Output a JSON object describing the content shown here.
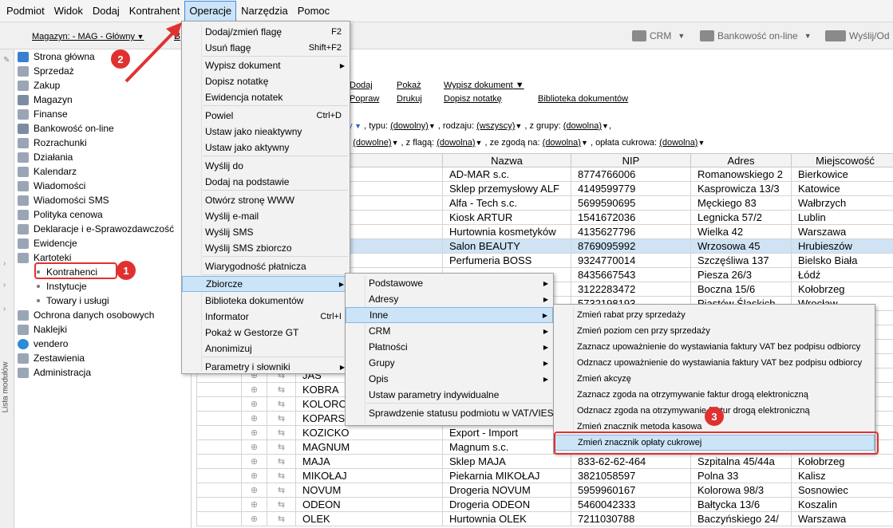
{
  "menubar": [
    "Podmiot",
    "Widok",
    "Dodaj",
    "Kontrahent",
    "Operacje",
    "Narzędzia",
    "Pomoc"
  ],
  "toolbar": {
    "magazyn": "Magazyn: - MAG - Główny",
    "b_label": "B",
    "crm": "CRM",
    "bankowosc": "Bankowość on-line",
    "wyslij": "Wyślij/Od"
  },
  "vstrip_label": "Lista modułów",
  "sidebar": {
    "items": [
      "Strona główna",
      "Sprzedaż",
      "Zakup",
      "Magazyn",
      "Finanse",
      "Bankowość on-line",
      "Rozrachunki",
      "Działania",
      "Kalendarz",
      "Wiadomości",
      "Wiadomości SMS",
      "Polityka cenowa",
      "Deklaracje i e-Sprawozdawczość",
      "Ewidencje",
      "Kartoteki"
    ],
    "kartoteki_sub": [
      "Kontrahenci",
      "Instytucje",
      "Towary i usługi"
    ],
    "items_after": [
      "Ochrona danych osobowych",
      "Naklejki",
      "vendero",
      "Zestawienia",
      "Administracja"
    ]
  },
  "actions": {
    "row1": [
      "Dodaj",
      "Pokaż",
      "Wypisz dokument"
    ],
    "row2": [
      "Popraw",
      "Drukuj",
      "Dopisz notatkę",
      "Biblioteka dokumentów"
    ]
  },
  "filters": {
    "line1_typu": ", typu:",
    "line1_typu_val": "(dowolny)",
    "line1_rodzaju": ", rodzaju:",
    "line1_rodzaju_val": "(wszyscy)",
    "line1_grupy": ", z grupy:",
    "line1_grupy_val": "(dowolna)",
    "line1_tail": ",",
    "line2_a": "a:",
    "line2_a_val": "(dowolne)",
    "line2_flaga": ", z flagą:",
    "line2_flaga_val": "(dowolna)",
    "line2_zgoda": ", ze zgodą na:",
    "line2_zgoda_val": "(dowolna)",
    "line2_oplata": ", opłata cukrowa:",
    "line2_oplata_val": "(dowolna)",
    "line1_cut": "ny"
  },
  "table": {
    "headers": [
      "ymbol",
      "Nazwa",
      "NIP",
      "Adres",
      "Miejscowość"
    ],
    "rows": [
      [
        "",
        "AD-MAR s.c.",
        "8774766006",
        "Romanowskiego 2",
        "Bierkowice"
      ],
      [
        "",
        "Sklep przemysłowy ALF",
        "4149599779",
        "Kasprowicza  13/3",
        "Katowice"
      ],
      [
        "",
        "Alfa - Tech s.c.",
        "5699590695",
        "Męckiego  83",
        "Wałbrzych"
      ],
      [
        "",
        "Kiosk ARTUR",
        "1541672036",
        "Legnicka  57/2",
        "Lublin"
      ],
      [
        "",
        "Hurtownia kosmetyków",
        "4135627796",
        "Wielka  42",
        "Warszawa"
      ],
      [
        "",
        "Salon BEAUTY",
        "8769095992",
        "Wrzosowa  45",
        "Hrubieszów"
      ],
      [
        "",
        "Perfumeria BOSS",
        "9324770014",
        "Szczęśliwa  137",
        "Bielsko Biała"
      ],
      [
        "",
        "",
        "8435667543",
        "Piesza  26/3",
        "Łódź"
      ],
      [
        "",
        "",
        "3122283472",
        "Boczna  15/6",
        "Kołobrzeg"
      ],
      [
        "",
        "",
        "5732198193",
        "Piastów Śląskich",
        "Wrocław"
      ],
      [
        "",
        "",
        "",
        "",
        ""
      ],
      [
        "",
        "",
        "",
        "",
        ""
      ],
      [
        "",
        "",
        "",
        "",
        ""
      ],
      [
        "",
        "",
        "",
        "",
        ""
      ],
      [
        "JAS",
        "",
        "",
        "",
        ""
      ],
      [
        "KOBRA",
        "",
        "",
        "",
        ""
      ],
      [
        "KOLORO",
        "",
        "",
        "",
        ""
      ],
      [
        "KOPARS",
        "",
        "",
        "",
        ""
      ],
      [
        "KOZICKO",
        "Export - Import",
        "",
        "",
        ""
      ],
      [
        "MAGNUM",
        "Magnum s.c.",
        "",
        "",
        ""
      ],
      [
        "MAJA",
        "Sklep MAJA",
        "833-62-62-464",
        "Szpitalna  45/44a",
        "Kołobrzeg"
      ],
      [
        "MIKOŁAJ",
        "Piekarnia MIKOŁAJ",
        "3821058597",
        "Polna  33",
        "Kalisz"
      ],
      [
        "NOVUM",
        "Drogeria NOVUM",
        "5959960167",
        "Kolorowa  98/3",
        "Sosnowiec"
      ],
      [
        "ODEON",
        "Drogeria ODEON",
        "5460042333",
        "Bałtycka  13/6",
        "Koszalin"
      ],
      [
        "OLEK",
        "Hurtownia OLEK",
        "7211030788",
        "Baczyńskiego  24/",
        "Warszawa"
      ]
    ]
  },
  "menu_operacje": [
    {
      "label": "Dodaj/zmień flagę",
      "shortcut": "F2"
    },
    {
      "label": "Usuń flagę",
      "shortcut": "Shift+F2"
    },
    {
      "label": "Wypisz dokument",
      "shortcut": "▶"
    },
    {
      "label": "Dopisz notatkę",
      "shortcut": ""
    },
    {
      "label": "Ewidencja notatek",
      "shortcut": ""
    },
    {
      "label": "Powiel",
      "shortcut": "Ctrl+D"
    },
    {
      "label": "Ustaw jako nieaktywny",
      "shortcut": ""
    },
    {
      "label": "Ustaw jako aktywny",
      "shortcut": ""
    },
    {
      "label": "Wyślij do",
      "shortcut": ""
    },
    {
      "label": "Dodaj na podstawie",
      "shortcut": ""
    },
    {
      "label": "Otwórz stronę WWW",
      "shortcut": ""
    },
    {
      "label": "Wyślij e-mail",
      "shortcut": ""
    },
    {
      "label": "Wyślij SMS",
      "shortcut": ""
    },
    {
      "label": "Wyślij SMS zbiorczo",
      "shortcut": ""
    },
    {
      "label": "Wiarygodność płatnicza",
      "shortcut": ""
    },
    {
      "label": "Zbiorcze",
      "shortcut": "▶"
    },
    {
      "label": "Biblioteka dokumentów",
      "shortcut": ""
    },
    {
      "label": "Informator",
      "shortcut": "Ctrl+I"
    },
    {
      "label": "Pokaż w Gestorze GT",
      "shortcut": ""
    },
    {
      "label": "Anonimizuj",
      "shortcut": ""
    },
    {
      "label": "Parametry i słowniki",
      "shortcut": "▶"
    }
  ],
  "menu_zbiorcze": [
    {
      "label": "Podstawowe",
      "shortcut": "▶"
    },
    {
      "label": "Adresy",
      "shortcut": "▶"
    },
    {
      "label": "Inne",
      "shortcut": "▶"
    },
    {
      "label": "CRM",
      "shortcut": "▶"
    },
    {
      "label": "Płatności",
      "shortcut": "▶"
    },
    {
      "label": "Grupy",
      "shortcut": "▶"
    },
    {
      "label": "Opis",
      "shortcut": "▶"
    },
    {
      "label": "Ustaw parametry indywidualne",
      "shortcut": ""
    },
    {
      "label": "Sprawdzenie statusu podmiotu w VAT/VIES",
      "shortcut": ""
    }
  ],
  "menu_inne": [
    "Zmień rabat przy sprzedaży",
    "Zmień poziom cen przy sprzedaży",
    "Zaznacz upoważnienie do wystawiania faktury VAT bez podpisu odbiorcy",
    "Odznacz upoważnienie do wystawiania faktury VAT bez podpisu odbiorcy",
    "Zmień akcyzę",
    "Zaznacz zgoda na otrzymywanie faktur drogą elektroniczną",
    "Odznacz zgoda na otrzymywanie faktur drogą elektroniczną",
    "Zmień znacznik metoda kasowa",
    "Zmień znacznik opłaty cukrowej"
  ],
  "badges": [
    "1",
    "2",
    "3"
  ],
  "colors": {
    "accent": "#e03131",
    "selection": "#cfe3f5",
    "highlight": "#cce4f7"
  }
}
